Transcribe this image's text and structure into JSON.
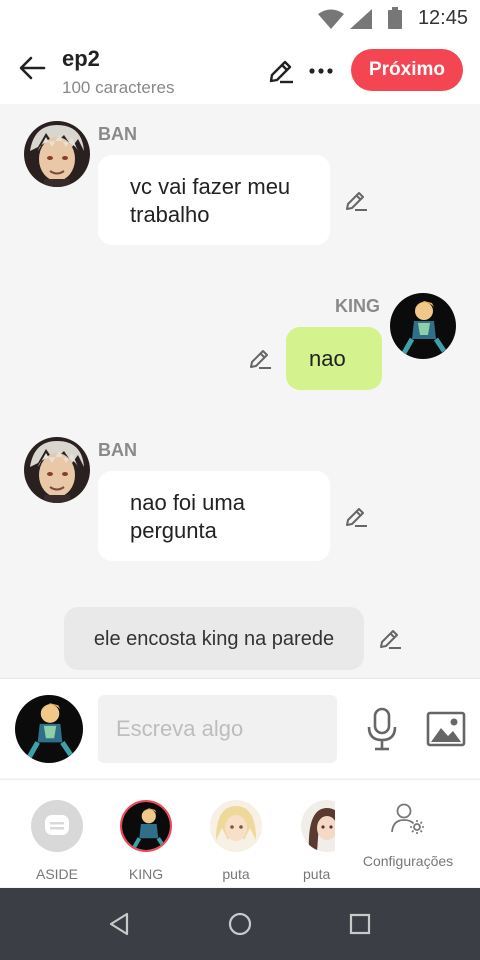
{
  "status_bar": {
    "time": "12:45"
  },
  "header": {
    "title": "ep2",
    "subtitle": "100 caracteres",
    "next_label": "Próximo"
  },
  "messages": [
    {
      "speaker": "BAN",
      "text_lines": [
        "vc vai fazer meu",
        "trabalho"
      ],
      "side": "left"
    },
    {
      "speaker": "KING",
      "text_lines": [
        "nao"
      ],
      "side": "right"
    },
    {
      "speaker": "BAN",
      "text_lines": [
        "nao foi uma",
        "pergunta"
      ],
      "side": "left"
    },
    {
      "aside": "ele encosta king na parede"
    }
  ],
  "composer": {
    "placeholder": "Escreva algo"
  },
  "characters": [
    {
      "name": "ASIDE"
    },
    {
      "name": "KING"
    },
    {
      "name": "puta"
    },
    {
      "name": "puta"
    }
  ],
  "settings_label": "Configurações",
  "colors": {
    "accent": "#f44652",
    "user_bubble": "#d4f28e",
    "aside_bubble": "#e9e9e9",
    "nav_bar": "#3b3f45"
  }
}
